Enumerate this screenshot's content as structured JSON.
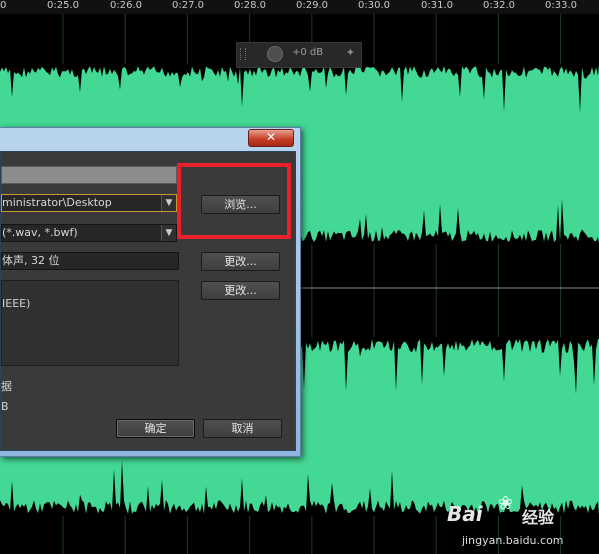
{
  "timeline": {
    "ticks": [
      "0:25.0",
      "0:26.0",
      "0:27.0",
      "0:28.0",
      "0:29.0",
      "0:30.0",
      "0:31.0",
      "0:32.0",
      "0:33.0"
    ],
    "first_tick_partial": "0"
  },
  "hud": {
    "gain_label": "+0 dB"
  },
  "colors": {
    "waveform": "#43d894",
    "background": "#000000",
    "highlight": "#e8202a"
  },
  "dialog": {
    "close_symbol": "✕",
    "filename_value": "",
    "location_value": "ministrator\\Desktop",
    "format_value": "(*.wav, *.bwf)",
    "browse_label": "浏览...",
    "sample_type_value": "体声, 32 位",
    "change_label_1": "更改...",
    "change_label_2": "更改...",
    "format_settings_text": "IEEE)",
    "metadata_label": "据",
    "size_label": "B",
    "ok_label": "确定",
    "cancel_label": "取消"
  },
  "watermark": {
    "brand_left": "Bai",
    "brand_right": "经验",
    "url": "jingyan.baidu.com"
  }
}
